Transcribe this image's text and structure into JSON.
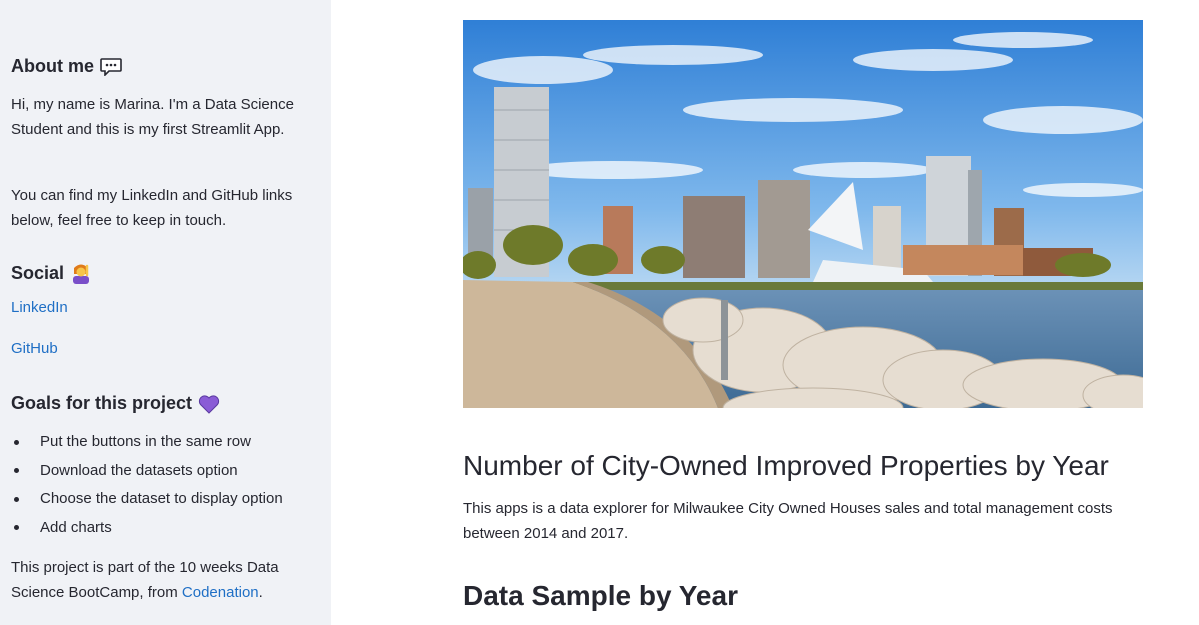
{
  "sidebar": {
    "about": {
      "heading": "About me",
      "icon": "speech-bubble-icon",
      "para1": "Hi, my name is Marina. I'm a Data Science Student and this is my first Streamlit App.",
      "para2": "You can find my LinkedIn and GitHub links below, feel free to keep in touch."
    },
    "social": {
      "heading": "Social",
      "icon": "person-raising-hand-icon",
      "links": [
        "LinkedIn",
        "GitHub"
      ]
    },
    "goals": {
      "heading": "Goals for this project",
      "icon": "purple-heart-icon",
      "items": [
        "Put the buttons in the same row",
        "Download the datasets option",
        "Choose the dataset to display option",
        "Add charts"
      ],
      "footer_prefix": "This project is part of the 10 weeks Data Science BootCamp, from ",
      "footer_link": "Codenation",
      "footer_suffix": "."
    }
  },
  "main": {
    "title": "Number of City-Owned Improved Properties by Year",
    "description": "This apps is a data explorer for Milwaukee City Owned Houses sales and total management costs between 2014 and 2017.",
    "section_heading": "Data Sample by Year"
  },
  "colors": {
    "sidebar_bg": "#f0f2f6",
    "link": "#1f6fc5",
    "text": "#262730",
    "heart": "#8a5cd6"
  }
}
